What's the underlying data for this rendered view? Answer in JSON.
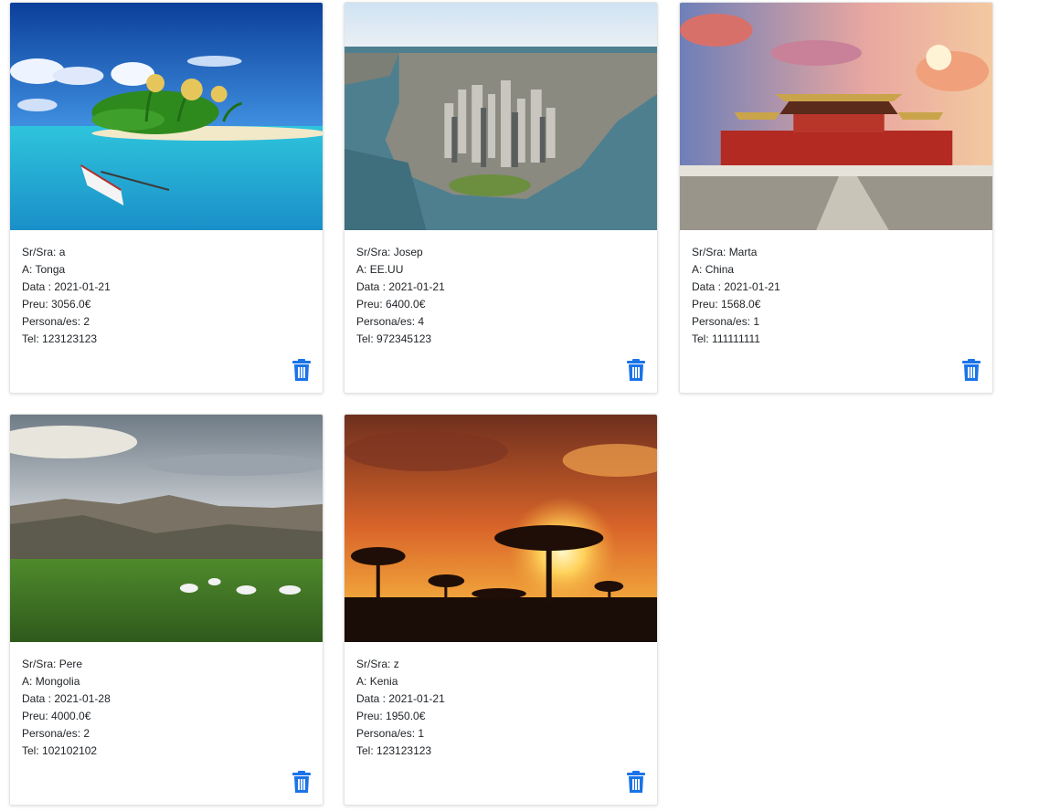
{
  "colors": {
    "accent": "#1a73e8",
    "border": "#e4e4e4"
  },
  "labels": {
    "client": "Sr/Sra:",
    "destination": "A:",
    "date": "Data :",
    "price": "Preu:",
    "people": "Persona/es:",
    "phone": "Tel:"
  },
  "bookings": [
    {
      "client": "a",
      "destination": "Tonga",
      "date": "2021-01-21",
      "price": "3056.0€",
      "people": "2",
      "phone": "123123123",
      "image": "tropical-island-photo",
      "delete_icon": "trash-icon"
    },
    {
      "client": "Josep",
      "destination": "EE.UU",
      "date": "2021-01-21",
      "price": "6400.0€",
      "people": "4",
      "phone": "972345123",
      "image": "new-york-aerial-photo",
      "delete_icon": "trash-icon"
    },
    {
      "client": "Marta",
      "destination": "China",
      "date": "2021-01-21",
      "price": "1568.0€",
      "people": "1",
      "phone": "111111111",
      "image": "forbidden-city-photo",
      "delete_icon": "trash-icon"
    },
    {
      "client": "Pere",
      "destination": "Mongolia",
      "date": "2021-01-28",
      "price": "4000.0€",
      "people": "2",
      "phone": "102102102",
      "image": "mongolian-steppe-photo",
      "delete_icon": "trash-icon"
    },
    {
      "client": "z",
      "destination": "Kenia",
      "date": "2021-01-21",
      "price": "1950.0€",
      "people": "1",
      "phone": "123123123",
      "image": "savanna-sunset-photo",
      "delete_icon": "trash-icon"
    }
  ]
}
